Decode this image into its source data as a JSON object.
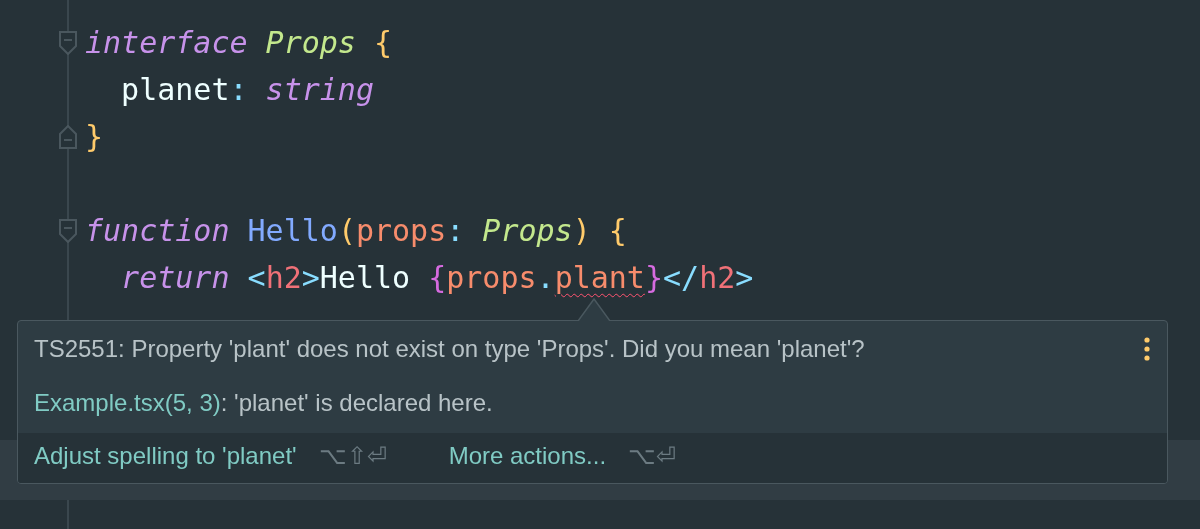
{
  "editor": {
    "lines": [
      {
        "kind": "fold_start",
        "tokens": [
          {
            "text": "interface",
            "kind": "keyword",
            "error": false
          },
          {
            "text": " Props",
            "kind": "type",
            "error": false
          },
          {
            "text": " {",
            "kind": "brace",
            "error": false
          }
        ]
      },
      {
        "kind": "code",
        "tokens": [
          {
            "text": "  planet",
            "kind": "plain",
            "error": false
          },
          {
            "text": ":",
            "kind": "punct",
            "error": false
          },
          {
            "text": " string",
            "kind": "keyword",
            "error": false
          }
        ]
      },
      {
        "kind": "fold_end",
        "tokens": [
          {
            "text": "}",
            "kind": "brace",
            "error": false
          }
        ]
      },
      {
        "kind": "blank"
      },
      {
        "kind": "fold_start",
        "tokens": [
          {
            "text": "function",
            "kind": "keyword",
            "error": false
          },
          {
            "text": " Hello",
            "kind": "function",
            "error": false
          },
          {
            "text": "(",
            "kind": "brace",
            "error": false
          },
          {
            "text": "props",
            "kind": "param",
            "error": false
          },
          {
            "text": ":",
            "kind": "punct",
            "error": false
          },
          {
            "text": " Props",
            "kind": "type",
            "error": false
          },
          {
            "text": ")",
            "kind": "brace",
            "error": false
          },
          {
            "text": " {",
            "kind": "brace",
            "error": false
          }
        ]
      },
      {
        "kind": "code",
        "tokens": [
          {
            "text": "  return",
            "kind": "keyword",
            "error": false
          },
          {
            "text": " <",
            "kind": "punct",
            "error": false
          },
          {
            "text": "h2",
            "kind": "tag",
            "error": false
          },
          {
            "text": ">",
            "kind": "punct",
            "error": false
          },
          {
            "text": "Hello",
            "kind": "plain",
            "error": false
          },
          {
            "text": " {",
            "kind": "jsxbrace",
            "error": false
          },
          {
            "text": "props",
            "kind": "param",
            "error": false
          },
          {
            "text": ".",
            "kind": "punct",
            "error": false
          },
          {
            "text": "plant",
            "kind": "param",
            "error": true
          },
          {
            "text": "}",
            "kind": "jsxbrace",
            "error": false
          },
          {
            "text": "</",
            "kind": "punct",
            "error": false
          },
          {
            "text": "h2",
            "kind": "tag",
            "error": false
          },
          {
            "text": ">",
            "kind": "punct",
            "error": false
          }
        ]
      }
    ]
  },
  "popup": {
    "message": "TS2551: Property 'plant' does not exist on type 'Props'. Did you mean 'planet'?",
    "location_link": "Example.tsx(5, 3)",
    "location_text": ": 'planet' is declared here.",
    "actions": [
      {
        "label": "Adjust spelling to 'planet'",
        "shortcut": "⌥⇧⏎"
      },
      {
        "label": "More actions...",
        "shortcut": "⌥⏎"
      }
    ]
  }
}
